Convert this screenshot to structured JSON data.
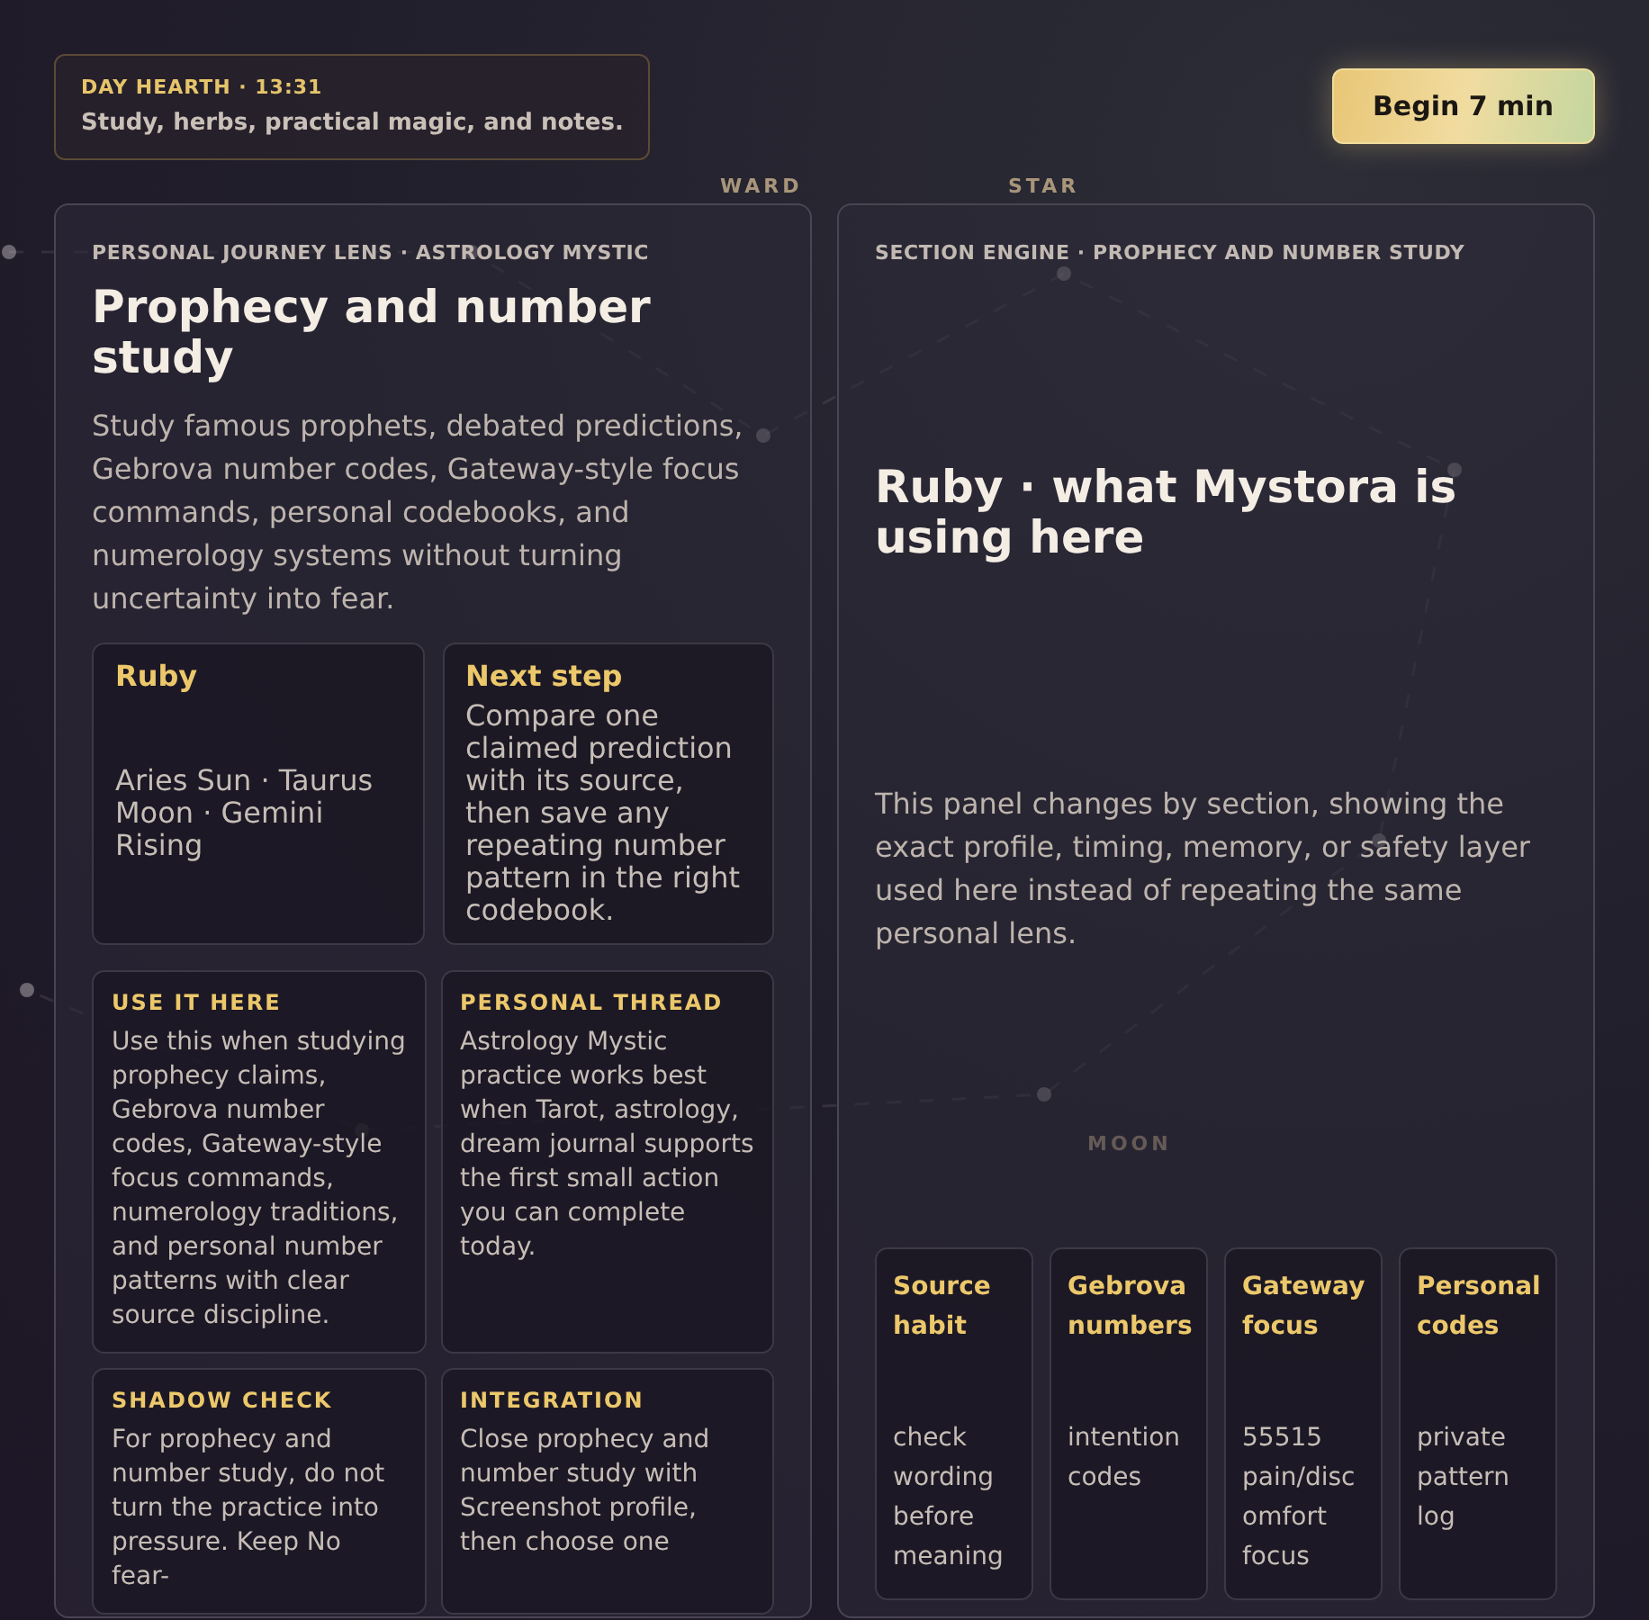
{
  "header": {
    "kicker": "DAY HEARTH · 13:31",
    "subtitle": "Study, herbs, practical magic, and notes."
  },
  "begin_button": {
    "label": "Begin 7 min"
  },
  "lens_panel": {
    "kicker": "PERSONAL JOURNEY LENS · ASTROLOGY MYSTIC",
    "title": "Prophecy and number study",
    "body": "Study famous prophets, debated predictions, Gebrova number codes, Gateway-style focus commands, personal codebooks, and numerology systems without turning uncertainty into fear.",
    "profile_cards": [
      {
        "title": "Ruby",
        "text": "Aries Sun · Taurus Moon · Gemini Rising"
      },
      {
        "title": "Next step",
        "text": "Compare one claimed prediction with its source, then save any repeating number pattern in the right codebook."
      }
    ],
    "guide_cards": [
      {
        "label": "USE IT HERE",
        "text": "Use this when studying prophecy claims, Gebrova number codes, Gateway-style focus commands, numerology traditions, and personal number patterns with clear source discipline."
      },
      {
        "label": "PERSONAL THREAD",
        "text": "Astrology Mystic practice works best when Tarot, astrology, dream journal supports the first small action you can complete today."
      },
      {
        "label": "SHADOW CHECK",
        "text": "For prophecy and number study, do not turn the practice into pressure. Keep No fear-"
      },
      {
        "label": "INTEGRATION",
        "text": "Close prophecy and number study with Screenshot profile, then choose one"
      }
    ]
  },
  "engine_panel": {
    "kicker": "SECTION ENGINE · PROPHECY AND NUMBER STUDY",
    "title": "Ruby · what Mystora is using here",
    "body": "This panel changes by section, showing the exact profile, timing, memory, or safety layer used here instead of repeating the same personal lens.",
    "tiles": [
      {
        "title": "Source habit",
        "text": "check wording before meaning"
      },
      {
        "title": "Gebrova numbers",
        "text": "intention codes"
      },
      {
        "title": "Gateway focus",
        "text": "55515 pain/discomfort focus"
      },
      {
        "title": "Personal codes",
        "text": "private pattern log"
      }
    ]
  },
  "constellation_labels": [
    "WARD",
    "STAR",
    "MOON"
  ]
}
